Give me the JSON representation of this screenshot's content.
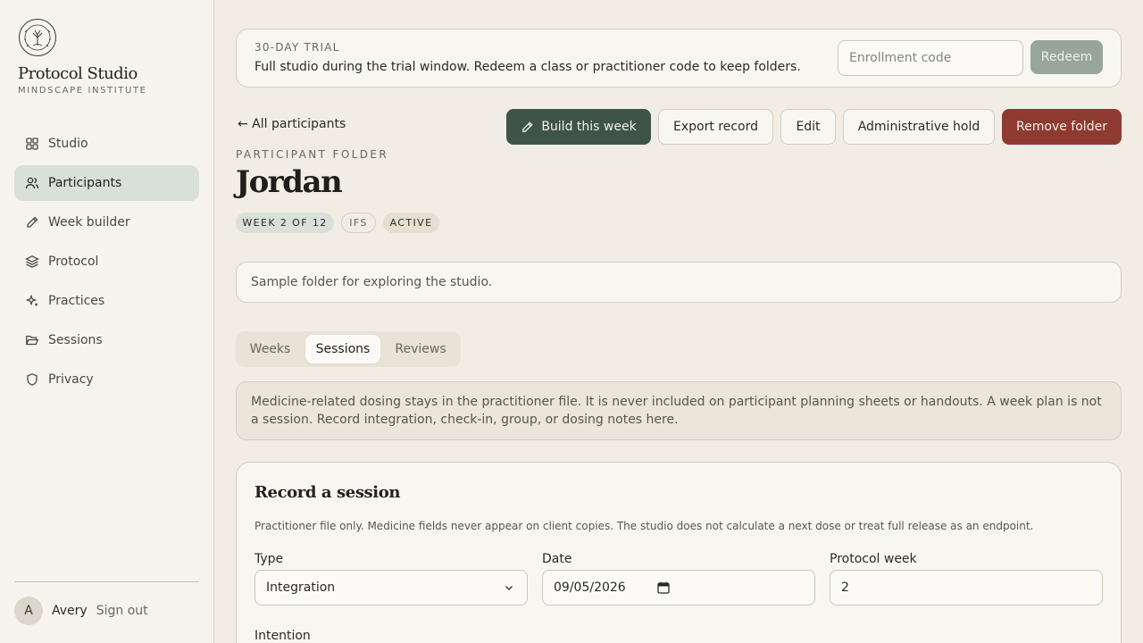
{
  "brand": {
    "title": "Protocol Studio",
    "subtitle": "MINDSCAPE INSTITUTE",
    "logo_text": "MINDSCAPE INSTITUTE"
  },
  "nav": {
    "items": [
      {
        "label": "Studio",
        "icon": "grid-icon"
      },
      {
        "label": "Participants",
        "icon": "users-icon",
        "active": true
      },
      {
        "label": "Week builder",
        "icon": "pencil-icon"
      },
      {
        "label": "Protocol",
        "icon": "layers-icon"
      },
      {
        "label": "Practices",
        "icon": "sparkles-icon"
      },
      {
        "label": "Sessions",
        "icon": "folder-open-icon"
      },
      {
        "label": "Privacy",
        "icon": "shield-icon"
      }
    ]
  },
  "user": {
    "initial": "A",
    "name": "Avery",
    "signout": "Sign out"
  },
  "trial": {
    "label": "30-DAY TRIAL",
    "text": "Full studio during the trial window. Redeem a class or practitioner code to keep folders.",
    "code_placeholder": "Enrollment code",
    "redeem": "Redeem"
  },
  "header": {
    "back": "← All participants",
    "actions": {
      "build": "Build this week",
      "export": "Export record",
      "edit": "Edit",
      "hold": "Administrative hold",
      "remove": "Remove folder"
    }
  },
  "folder": {
    "label": "PARTICIPANT FOLDER",
    "name": "Jordan",
    "badges": {
      "week": "WEEK 2 OF 12",
      "modality": "IFS",
      "status": "ACTIVE"
    },
    "description": "Sample folder for exploring the studio."
  },
  "tabs": {
    "weeks": "Weeks",
    "sessions": "Sessions",
    "reviews": "Reviews",
    "selected": "Sessions"
  },
  "notice": "Medicine-related dosing stays in the practitioner file. It is never included on participant planning sheets or handouts. A week plan is not a session. Record integration, check-in, group, or dosing notes here.",
  "session_form": {
    "title": "Record a session",
    "note": "Practitioner file only. Medicine fields never appear on client copies. The studio does not calculate a next dose or treat full release as an endpoint.",
    "type_label": "Type",
    "type_value": "Integration",
    "date_label": "Date",
    "date_value": "09/05/2026",
    "week_label": "Protocol week",
    "week_value": "2",
    "intention_label": "Intention"
  },
  "colors": {
    "accent_green": "#3e5448",
    "danger": "#8e3a31",
    "active_nav": "#d8e0d9"
  }
}
